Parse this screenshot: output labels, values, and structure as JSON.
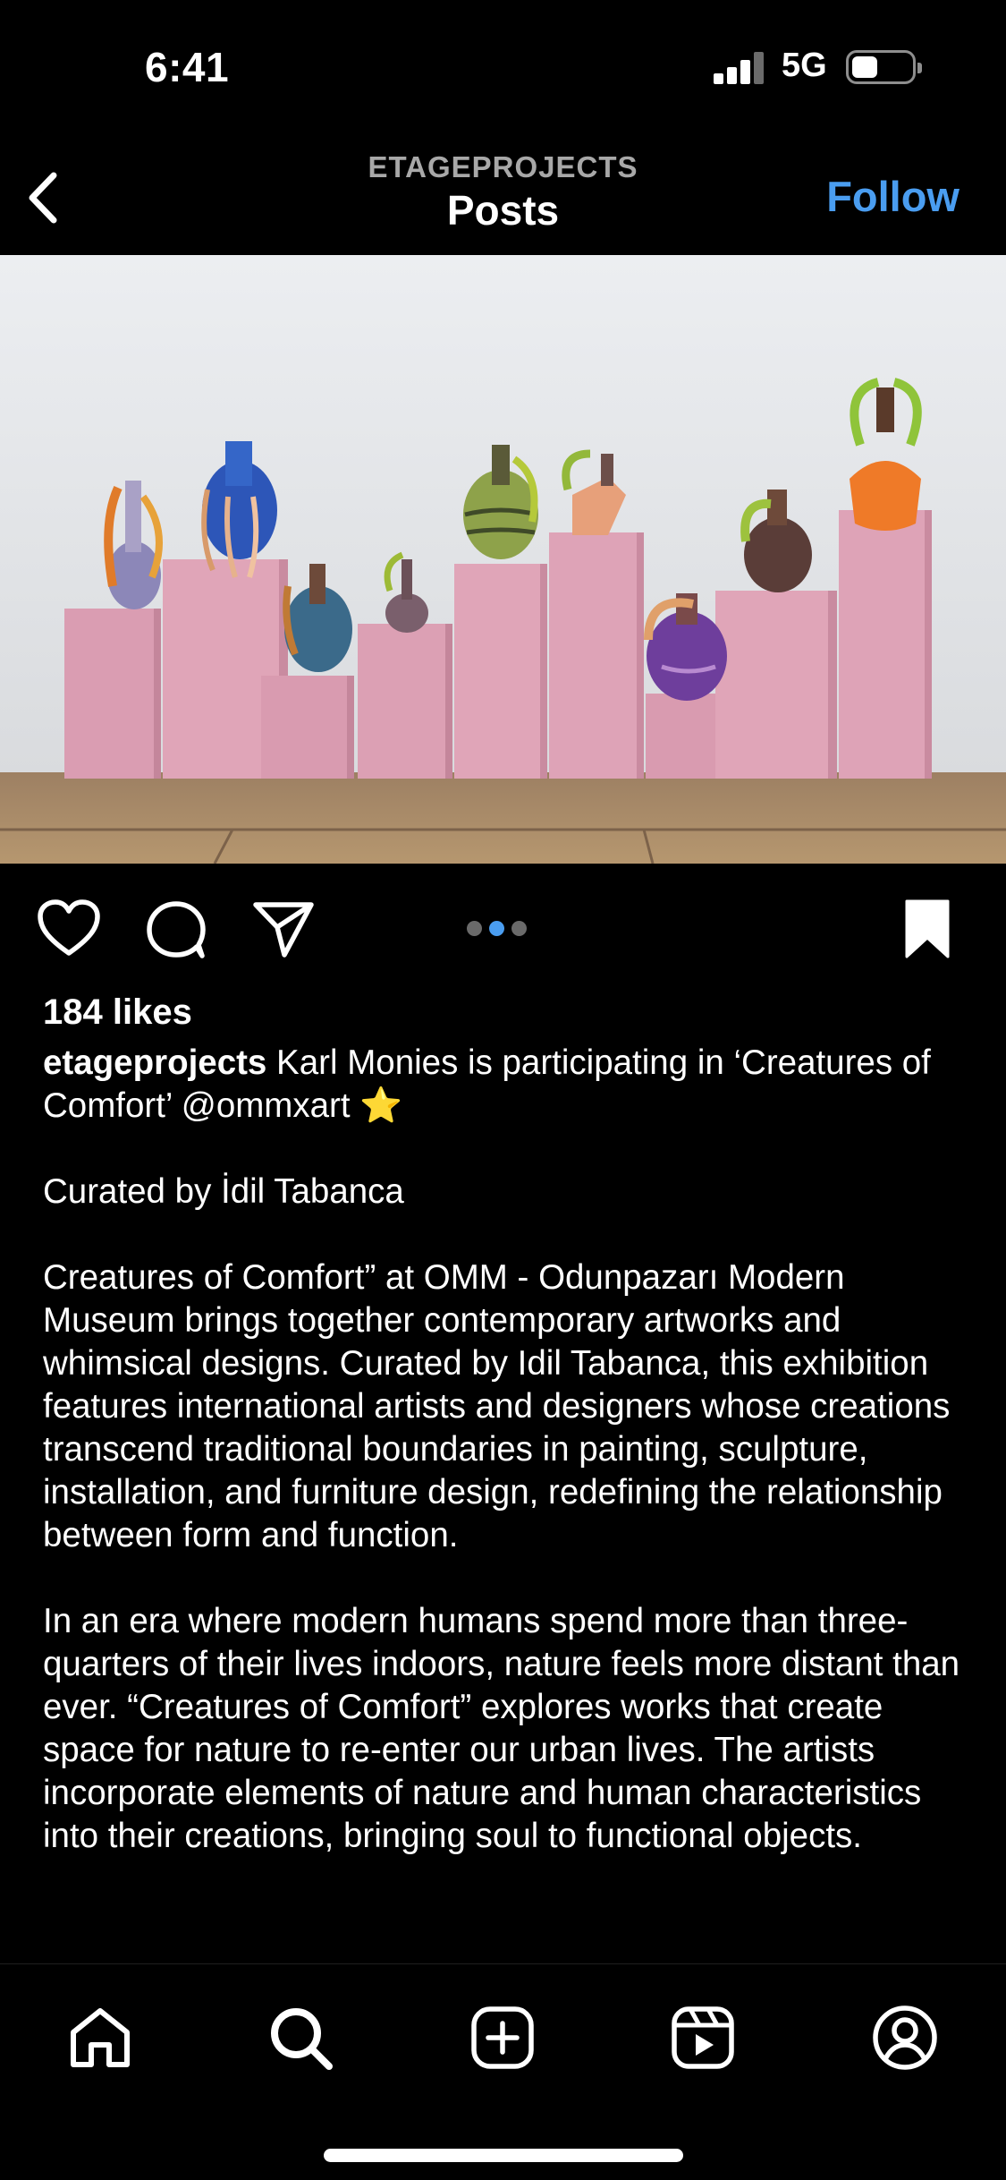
{
  "status_bar": {
    "time": "6:41",
    "network": "5G"
  },
  "header": {
    "account_label": "ETAGEPROJECTS",
    "title": "Posts",
    "follow_label": "Follow"
  },
  "post": {
    "carousel": {
      "count": 3,
      "active_index": 1
    },
    "likes": "184 likes",
    "username": "etageprojects",
    "caption_first": " Karl Monies is participating in ‘Creatures of Comfort’ @ommxart ",
    "caption_emoji": "⭐",
    "paragraphs": [
      "Curated by İdil Tabanca",
      "Creatures of Comfort” at OMM - Odunpazarı Modern Museum brings together contemporary artworks and whimsical designs. Curated by Idil Tabanca, this exhibition features international artists and designers whose creations transcend traditional boundaries in painting, sculpture, installation, and furniture design, redefining the relationship between form and function.",
      "In an era where modern humans spend more than three-quarters of their lives indoors, nature feels more distant than ever. “Creatures of Comfort” explores works that create space for nature to re-enter our urban lives. The artists incorporate elements of nature and human characteristics into their creations, bringing soul to functional objects."
    ]
  },
  "icons": {
    "back": "chevron-left-icon",
    "like": "heart-icon",
    "comment": "comment-bubble-icon",
    "share": "paper-plane-icon",
    "save": "bookmark-filled-icon",
    "tabs": [
      "home-icon",
      "search-icon",
      "create-plus-icon",
      "reels-icon",
      "profile-icon"
    ]
  },
  "colors": {
    "accent": "#4a9df0",
    "background": "#000000",
    "plinth": "#d99bb0"
  }
}
